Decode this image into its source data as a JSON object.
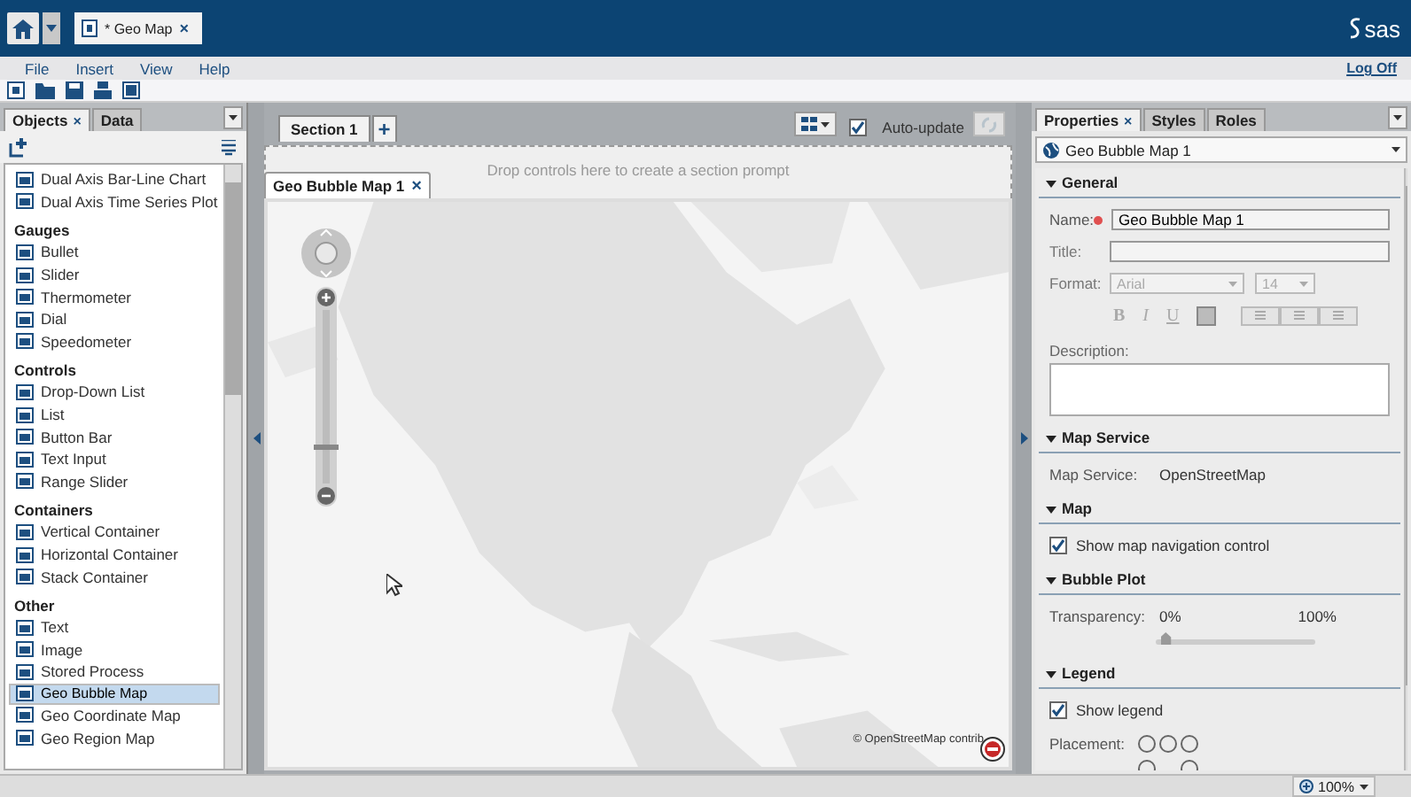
{
  "header": {
    "document_tab": {
      "label": "* Geo Map",
      "close": "×"
    },
    "logo": "sas"
  },
  "menu": {
    "items": [
      "File",
      "Insert",
      "View",
      "Help"
    ],
    "log_off": "Log Off"
  },
  "left_panel": {
    "tabs": [
      {
        "label": "Objects",
        "selected": true,
        "close": "×"
      },
      {
        "label": "Data",
        "selected": false
      }
    ],
    "groups": [
      {
        "items": [
          {
            "label": "Dual Axis Bar-Line Chart",
            "selected": false
          },
          {
            "label": "Dual Axis Time Series Plot",
            "selected": false
          }
        ]
      },
      {
        "title": "Gauges",
        "items": [
          {
            "label": "Bullet",
            "selected": false
          },
          {
            "label": "Slider",
            "selected": false
          },
          {
            "label": "Thermometer",
            "selected": false
          },
          {
            "label": "Dial",
            "selected": false
          },
          {
            "label": "Speedometer",
            "selected": false
          }
        ]
      },
      {
        "title": "Controls",
        "items": [
          {
            "label": "Drop-Down List",
            "selected": false
          },
          {
            "label": "List",
            "selected": false
          },
          {
            "label": "Button Bar",
            "selected": false
          },
          {
            "label": "Text Input",
            "selected": false
          },
          {
            "label": "Range Slider",
            "selected": false
          }
        ]
      },
      {
        "title": "Containers",
        "items": [
          {
            "label": "Vertical Container",
            "selected": false
          },
          {
            "label": "Horizontal Container",
            "selected": false
          },
          {
            "label": "Stack Container",
            "selected": false
          }
        ]
      },
      {
        "title": "Other",
        "items": [
          {
            "label": "Text",
            "selected": false
          },
          {
            "label": "Image",
            "selected": false
          },
          {
            "label": "Stored Process",
            "selected": false
          },
          {
            "label": "Geo Bubble Map",
            "selected": true
          },
          {
            "label": "Geo Coordinate Map",
            "selected": false
          },
          {
            "label": "Geo Region Map",
            "selected": false
          }
        ]
      }
    ]
  },
  "canvas": {
    "section_tab": {
      "label": "Section 1",
      "selected": true
    },
    "add": "+",
    "auto_update": {
      "label": "Auto-update",
      "checked": true
    },
    "prompt_hint": "Drop controls here to create a section prompt",
    "object_tab": {
      "label": "Geo Bubble Map 1",
      "close": "×"
    },
    "map": {
      "kind": "picture",
      "attribution": "© OpenStreetMap contrib"
    },
    "map_zoom": {
      "level": 0.2
    }
  },
  "right_panel": {
    "tabs": [
      {
        "label": "Properties",
        "selected": true,
        "close": "×"
      },
      {
        "label": "Styles",
        "selected": false
      },
      {
        "label": "Roles",
        "selected": false
      }
    ],
    "object_select": "Geo Bubble Map 1",
    "general": {
      "title": "General",
      "name_label": "Name:",
      "name_value": "Geo Bubble Map 1",
      "title_label": "Title:",
      "format_label": "Format:",
      "font": "Arial",
      "size": "14",
      "bold": "B",
      "italic": "I",
      "underline": "U",
      "description_label": "Description:"
    },
    "map_service": {
      "title": "Map Service",
      "label": "Map Service:",
      "value": "OpenStreetMap"
    },
    "map": {
      "title": "Map",
      "nav": {
        "label": "Show map navigation control",
        "checked": true
      }
    },
    "bubble_plot": {
      "title": "Bubble Plot",
      "label": "Transparency:",
      "min": "0%",
      "max": "100%",
      "level": 0.03
    },
    "legend": {
      "title": "Legend",
      "show": {
        "label": "Show legend",
        "checked": true
      },
      "placement_label": "Placement:",
      "placement": [
        {
          "selected": false
        },
        {
          "selected": false
        },
        {
          "selected": false
        },
        {
          "selected": false
        },
        {
          "selected": false
        }
      ]
    }
  },
  "status_bar": {
    "zoom": "100%"
  }
}
